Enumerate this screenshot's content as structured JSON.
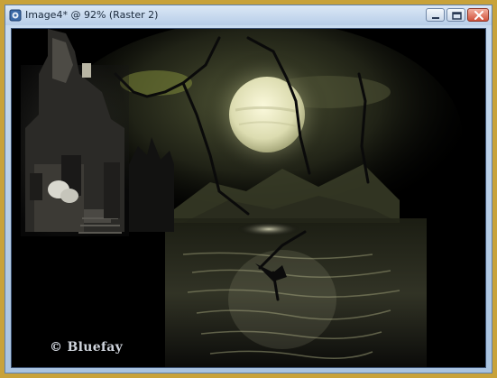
{
  "window": {
    "title": "Image4* @  92% (Raster 2)"
  },
  "controls": {
    "minimize": "minimize",
    "maximize": "maximize",
    "close": "close"
  },
  "canvas": {
    "watermark": "© Bluefay",
    "colors": {
      "moon": "#e9e8c4",
      "sky_tint": "#7f8a3a",
      "background": "#000000",
      "frame": "#c8a23a"
    }
  }
}
